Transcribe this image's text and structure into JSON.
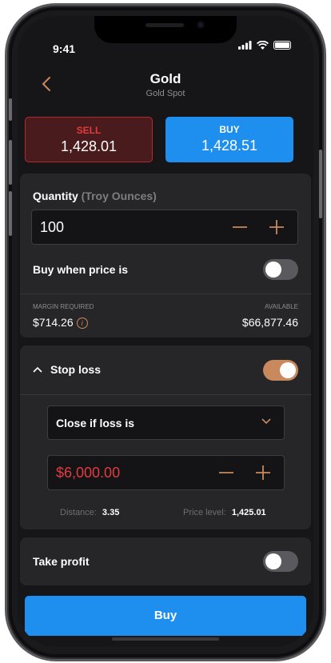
{
  "status": {
    "time": "9:41"
  },
  "header": {
    "title": "Gold",
    "subtitle": "Gold Spot",
    "back_icon": "chevron-left-icon"
  },
  "sell": {
    "label": "SELL",
    "price": "1,428.01"
  },
  "buy": {
    "label": "BUY",
    "price": "1,428.51"
  },
  "quantity": {
    "label": "Quantity",
    "unit": "(Troy Ounces)",
    "value": "100"
  },
  "buy_when": {
    "label": "Buy when price is",
    "enabled": false
  },
  "margin": {
    "caption": "MARGIN REQUIRED",
    "value": "$714.26"
  },
  "available": {
    "caption": "AVAILABLE",
    "value": "$66,877.46"
  },
  "stop_loss": {
    "label": "Stop loss",
    "enabled": true,
    "mode": "Close if loss is",
    "amount": "$6,000.00",
    "distance_label": "Distance:",
    "distance_value": "3.35",
    "price_level_label": "Price level:",
    "price_level_value": "1,425.01"
  },
  "take_profit": {
    "label": "Take profit",
    "enabled": false
  },
  "action": {
    "buy_label": "Buy"
  },
  "colors": {
    "accent": "#c8895c",
    "buy": "#1e8fee",
    "sell": "#e23b3f",
    "background": "#161618",
    "card": "#262629"
  }
}
